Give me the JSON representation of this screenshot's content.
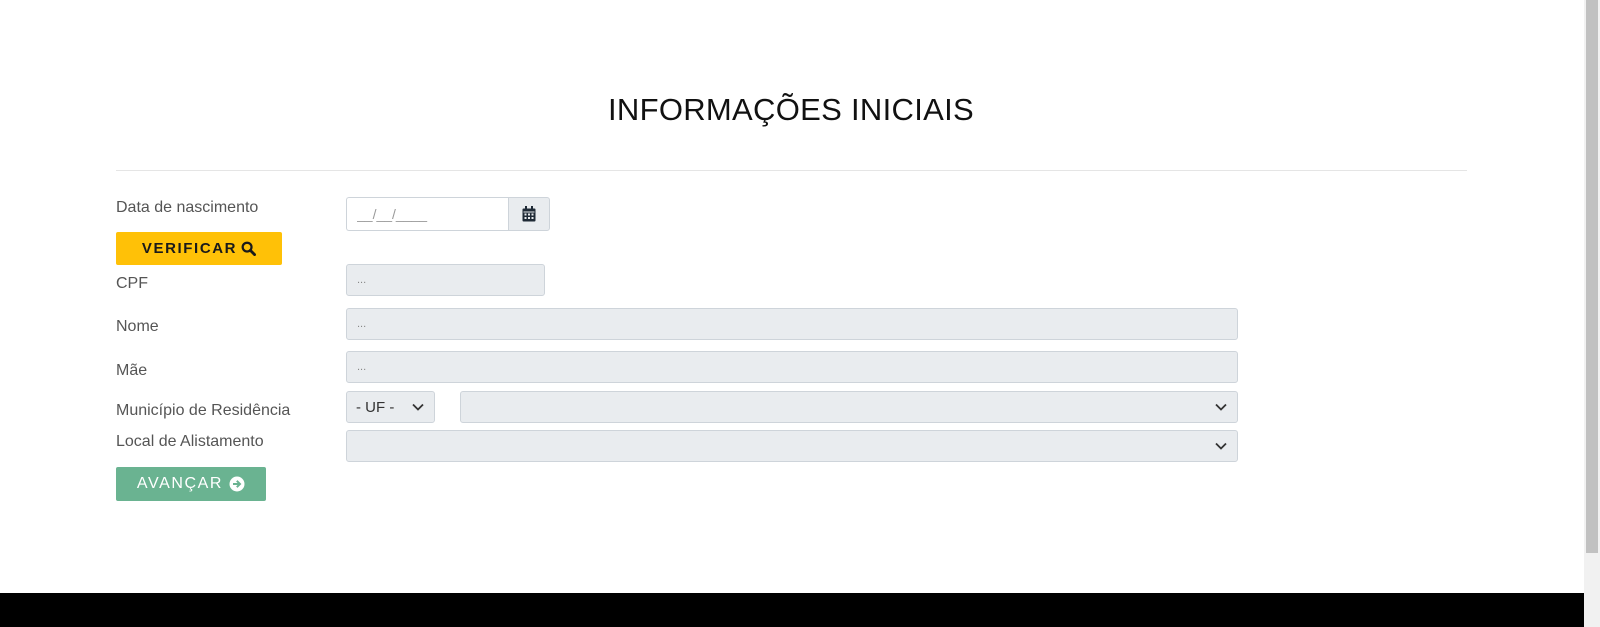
{
  "page": {
    "title": "INFORMAÇÕES INICIAIS"
  },
  "form": {
    "birth_date": {
      "label": "Data de nascimento",
      "placeholder": "__/__/____",
      "icon": "calendar-icon"
    },
    "verify_button": {
      "label": "VERIFICAR",
      "icon": "search-icon",
      "color": "#ffc107"
    },
    "cpf": {
      "label": "CPF",
      "placeholder": "..."
    },
    "nome": {
      "label": "Nome",
      "placeholder": "..."
    },
    "mae": {
      "label": "Mãe",
      "placeholder": "..."
    },
    "municipio": {
      "label": "Município de Residência",
      "uf_selected": "- UF -",
      "city_selected": ""
    },
    "local_alistamento": {
      "label": "Local de Alistamento",
      "selected": ""
    },
    "advance_button": {
      "label": "AVANÇAR",
      "icon": "arrow-circle-right-icon",
      "color": "#6ab391"
    }
  },
  "colors": {
    "readonly_bg": "#e9ecef",
    "footer": "#000000"
  }
}
